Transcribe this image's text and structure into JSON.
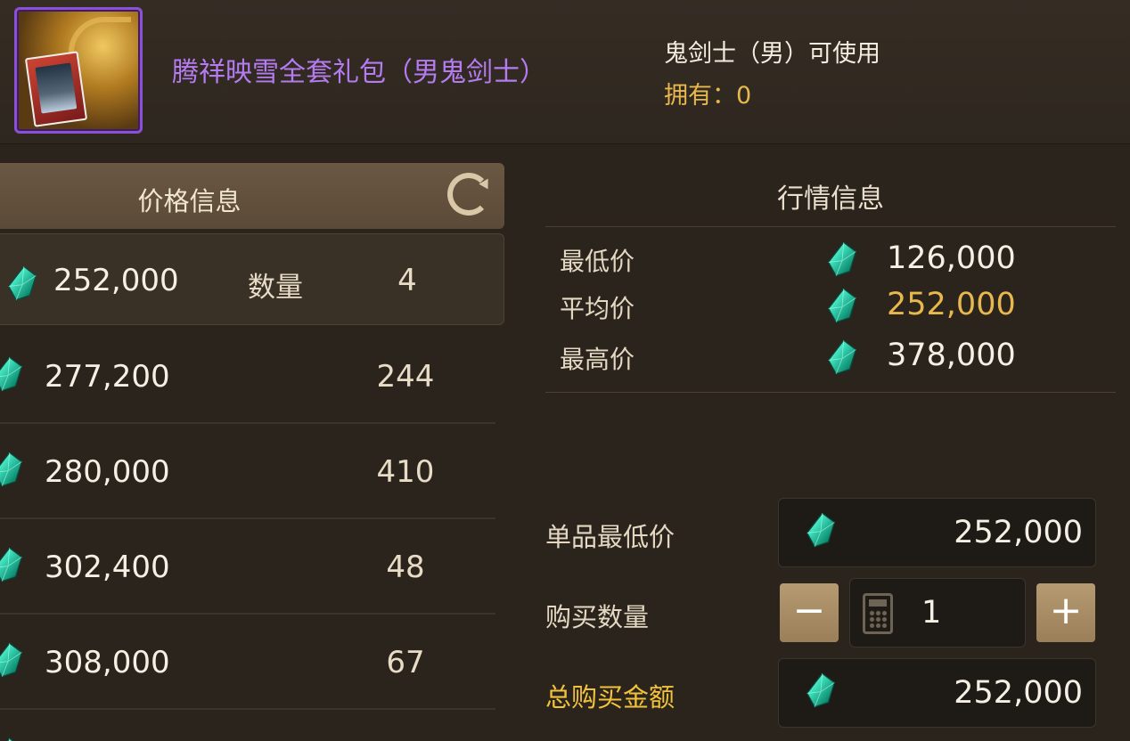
{
  "item": {
    "name": "腾祥映雪全套礼包（男鬼剑士）",
    "usable": "鬼剑士（男）可使用",
    "owned": "拥有：0"
  },
  "price_panel": {
    "title": "价格信息",
    "qty_label": "数量",
    "rows": [
      {
        "price": "252,000",
        "qty": "4"
      },
      {
        "price": "277,200",
        "qty": "244"
      },
      {
        "price": "280,000",
        "qty": "410"
      },
      {
        "price": "302,400",
        "qty": "48"
      },
      {
        "price": "308,000",
        "qty": "67"
      }
    ]
  },
  "market": {
    "title": "行情信息",
    "lowest_label": "最低价",
    "lowest_value": "126,000",
    "average_label": "平均价",
    "average_value": "252,000",
    "highest_label": "最高价",
    "highest_value": "378,000"
  },
  "purchase": {
    "unit_price_label": "单品最低价",
    "unit_price_value": "252,000",
    "quantity_label": "购买数量",
    "quantity_value": "1",
    "minus_label": "−",
    "plus_label": "+",
    "total_label": "总购买金额",
    "total_value": "252,000"
  },
  "colors": {
    "item_name": "#b57bf0",
    "owned": "#e8b74e",
    "average_value": "#e8b74e",
    "total_label": "#f2c23a",
    "gem": "#2fd6b0"
  }
}
